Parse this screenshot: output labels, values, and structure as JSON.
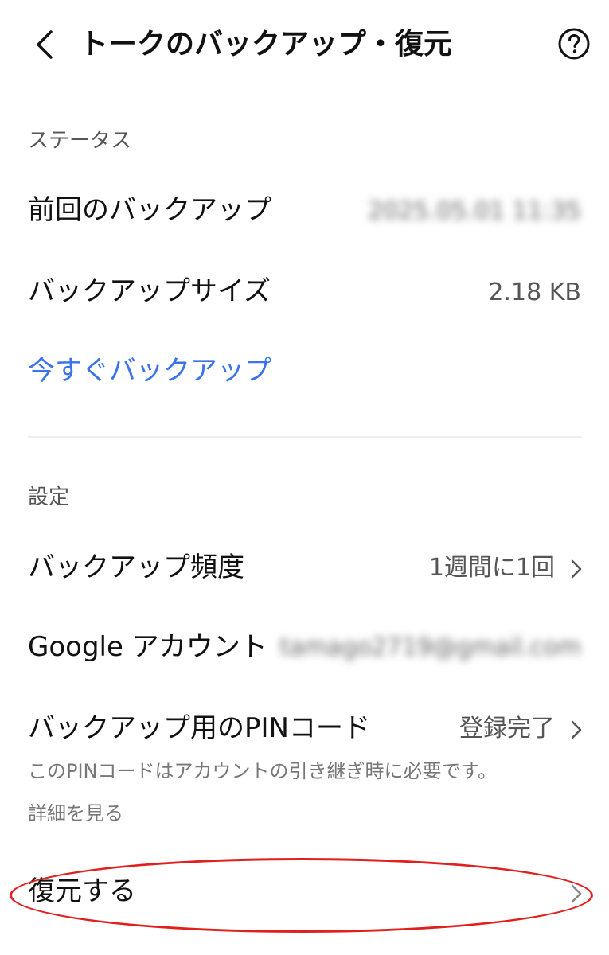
{
  "header": {
    "title": "トークのバックアップ・復元",
    "back_icon": "chevron-left-icon",
    "help_icon": "help-circle-icon"
  },
  "status_section": {
    "label": "ステータス",
    "last_backup_label": "前回のバックアップ",
    "last_backup_value": "2025.05.01 11:35",
    "backup_size_label": "バックアップサイズ",
    "backup_size_value": "2.18 KB",
    "backup_now_label": "今すぐバックアップ"
  },
  "settings_section": {
    "label": "設定",
    "frequency_label": "バックアップ頻度",
    "frequency_value": "1週間に1回",
    "google_account_label": "Google アカウント",
    "google_account_value": "tamago2719@gmail.com",
    "pin_label": "バックアップ用のPINコード",
    "pin_value": "登録完了",
    "pin_note": "このPINコードはアカウントの引き継ぎ時に必要です。",
    "details_link": "詳細を見る",
    "restore_label": "復元する"
  },
  "colors": {
    "link": "#3b73e8",
    "highlight": "#e0201f"
  }
}
